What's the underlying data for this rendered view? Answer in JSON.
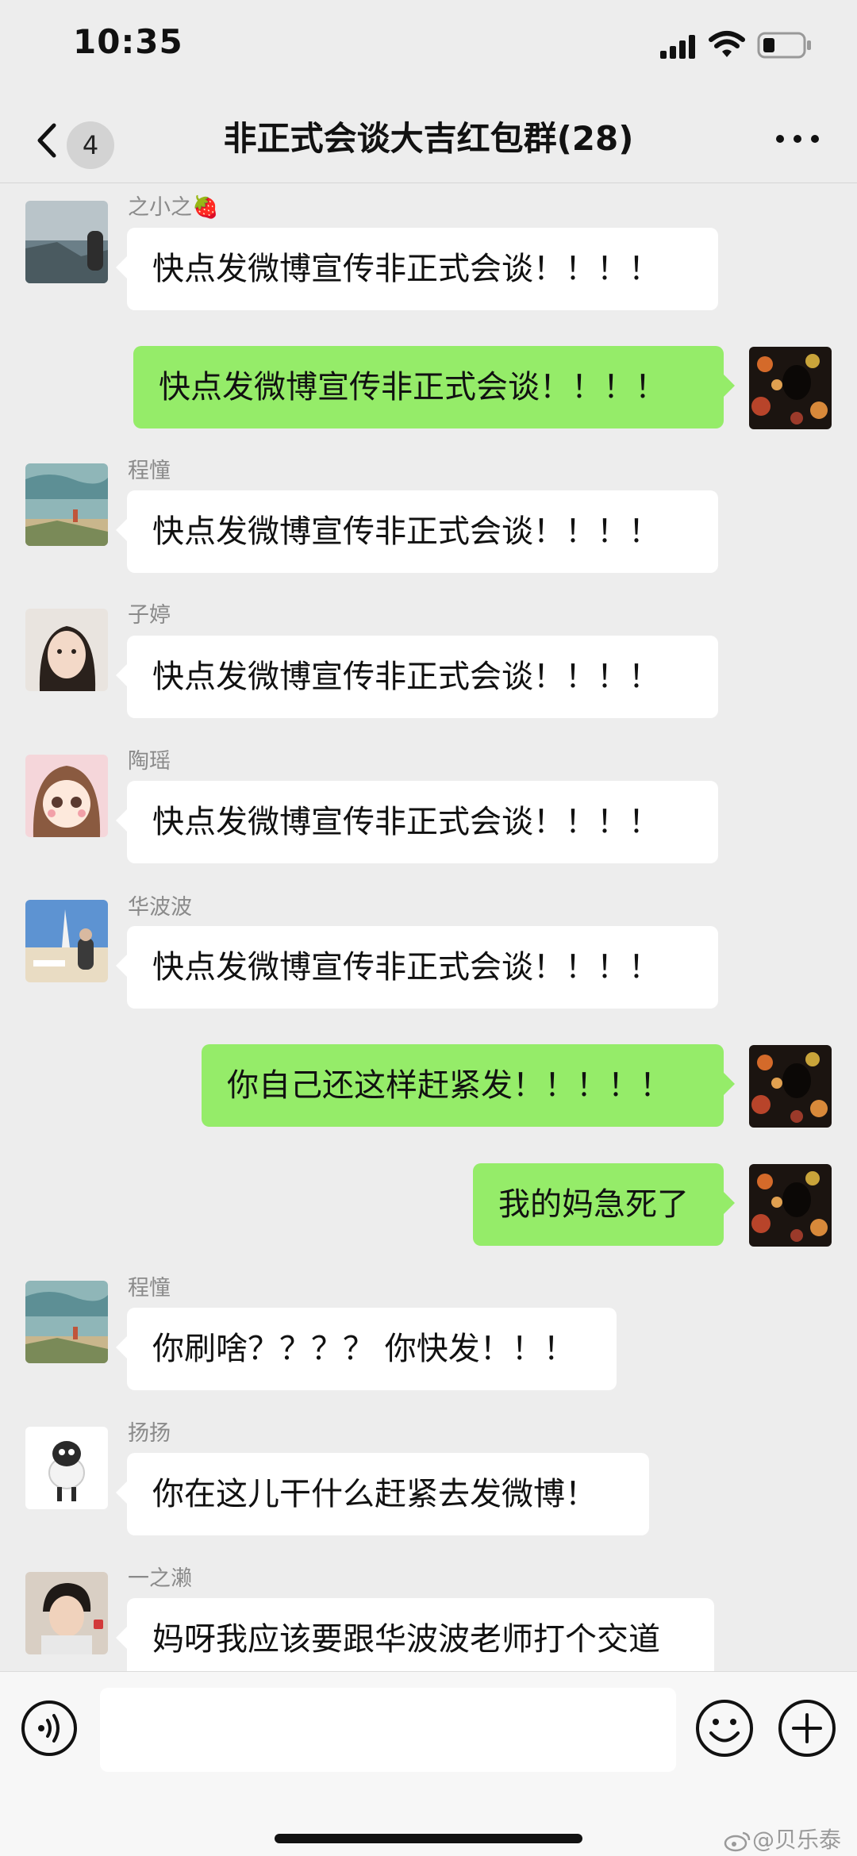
{
  "status_bar": {
    "time": "10:35"
  },
  "nav": {
    "unread_count": "4",
    "title": "非正式会谈大吉红包群(28)"
  },
  "messages": [
    {
      "sender": "之小之🍓",
      "text": "快点发微博宣传非正式会谈！！！！",
      "avatar": "seaside-photo"
    },
    {
      "sender": "",
      "text": "快点发微博宣传非正式会谈！！！！",
      "avatar": "bokeh-silhouette"
    },
    {
      "sender": "程憧",
      "text": "快点发微博宣传非正式会谈！！！！",
      "avatar": "coastal-painting"
    },
    {
      "sender": "子婷",
      "text": "快点发微博宣传非正式会谈！！！！",
      "avatar": "woman-portrait"
    },
    {
      "sender": "陶瑶",
      "text": "快点发微博宣传非正式会谈！！！！",
      "avatar": "anime-girl"
    },
    {
      "sender": "华波波",
      "text": "快点发微博宣传非正式会谈！！！！",
      "avatar": "beach-hotel"
    },
    {
      "sender": "",
      "text": "你自己还这样赶紧发！！！！！",
      "avatar": "bokeh-silhouette"
    },
    {
      "sender": "",
      "text": "我的妈急死了",
      "avatar": "bokeh-silhouette"
    },
    {
      "sender": "程憧",
      "text": "你刷啥？？？？ 你快发！！！",
      "avatar": "coastal-painting"
    },
    {
      "sender": "扬扬",
      "text": "你在这儿干什么赶紧去发微博！",
      "avatar": "sheep-plush"
    },
    {
      "sender": "一之濑",
      "text": "妈呀我应该要跟华波波老师打个交道",
      "avatar": "boy-portrait"
    }
  ],
  "input": {
    "placeholder": ""
  },
  "watermark": {
    "text": "@贝乐泰"
  },
  "colors": {
    "background": "#ededed",
    "outgoing_bubble": "#95ec69",
    "incoming_bubble": "#ffffff"
  },
  "icons": [
    "back-icon",
    "more-icon",
    "voice-icon",
    "emoji-icon",
    "plus-icon",
    "signal-icon",
    "wifi-icon",
    "battery-icon"
  ]
}
